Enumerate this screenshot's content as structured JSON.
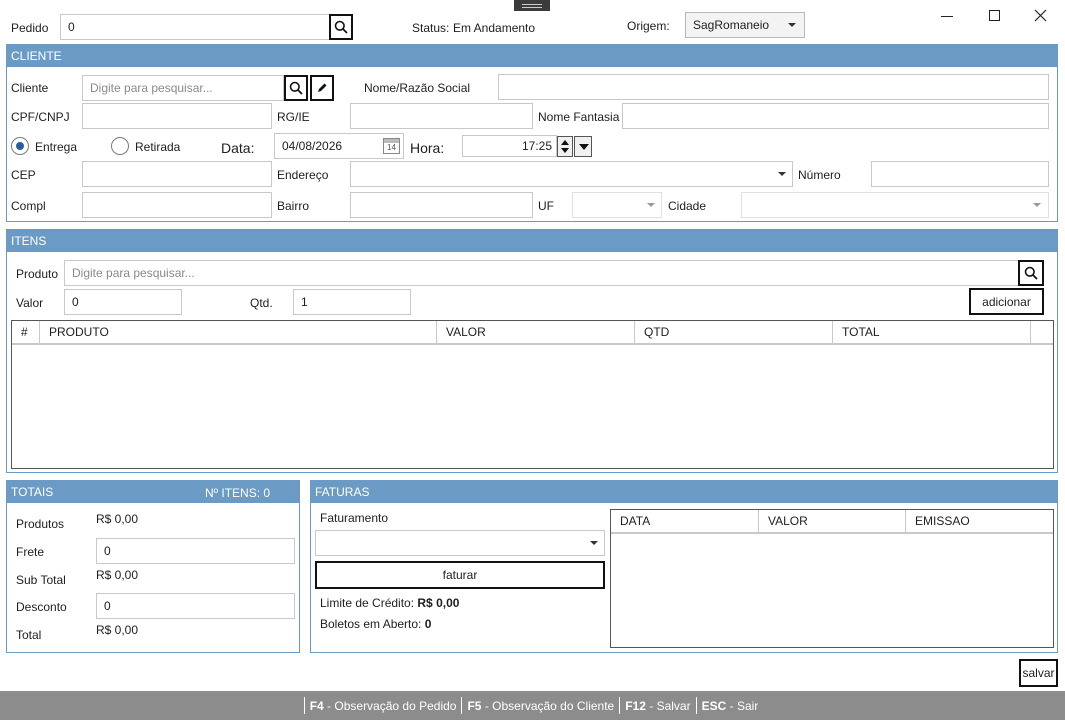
{
  "header": {
    "pedido_label": "Pedido",
    "pedido_value": "0",
    "status_label": "Status:",
    "status_value": "Em Andamento",
    "origem_label": "Origem:",
    "origem_value": "SagRomaneio"
  },
  "window_controls": [
    "minimize-icon",
    "maximize-icon",
    "close-icon"
  ],
  "cliente": {
    "title": "CLIENTE",
    "cliente_label": "Cliente",
    "cliente_placeholder": "Digite para pesquisar...",
    "razao_label": "Nome/Razão Social",
    "razao_value": "",
    "cpf_label": "CPF/CNPJ",
    "cpf_value": "",
    "rg_label": "RG/IE",
    "rg_value": "",
    "fantasia_label": "Nome Fantasia",
    "fantasia_value": "",
    "entrega_label": "Entrega",
    "retirada_label": "Retirada",
    "selected_mode": "Entrega",
    "data_label": "Data:",
    "data_value": "04/08/2026",
    "calendar_day": "14",
    "hora_label": "Hora:",
    "hora_value": "17:25",
    "cep_label": "CEP",
    "cep_value": "",
    "endereco_label": "Endereço",
    "endereco_value": "",
    "numero_label": "Número",
    "numero_value": "",
    "compl_label": "Compl",
    "compl_value": "",
    "bairro_label": "Bairro",
    "bairro_value": "",
    "uf_label": "UF",
    "uf_value": "",
    "cidade_label": "Cidade",
    "cidade_value": ""
  },
  "itens": {
    "title": "ITENS",
    "produto_label": "Produto",
    "produto_placeholder": "Digite para pesquisar...",
    "valor_label": "Valor",
    "valor_value": "0",
    "qtd_label": "Qtd.",
    "qtd_value": "1",
    "add_button": "adicionar",
    "columns": [
      "#",
      "PRODUTO",
      "VALOR",
      "QTD",
      "TOTAL"
    ],
    "rows": []
  },
  "totais": {
    "title": "TOTAIS",
    "count_text": "Nº ITENS: 0",
    "produtos_label": "Produtos",
    "produtos_value": "R$ 0,00",
    "frete_label": "Frete",
    "frete_value": "0",
    "subtotal_label": "Sub Total",
    "subtotal_value": "R$ 0,00",
    "desconto_label": "Desconto",
    "desconto_value": "0",
    "total_label": "Total",
    "total_value": "R$ 0,00"
  },
  "faturas": {
    "title": "FATURAS",
    "faturamento_label": "Faturamento",
    "faturamento_value": "",
    "faturar_button": "faturar",
    "limite_label": "Limite de Crédito:",
    "limite_value": "R$ 0,00",
    "boletos_label": "Boletos em Aberto:",
    "boletos_value": "0",
    "columns": [
      "DATA",
      "VALOR",
      "EMISSAO"
    ],
    "rows": []
  },
  "save_button": "salvar",
  "statusbar": {
    "shortcuts": [
      {
        "key": "F4",
        "text": " - Observação do Pedido"
      },
      {
        "key": "F5",
        "text": " - Observação do Cliente"
      },
      {
        "key": "F12",
        "text": " - Salvar"
      },
      {
        "key": "ESC",
        "text": " - Sair"
      }
    ]
  },
  "colors": {
    "section_header": "#6b9bc4",
    "statusbar": "#8c8c8c",
    "radio_selected": "#2d5da0"
  }
}
